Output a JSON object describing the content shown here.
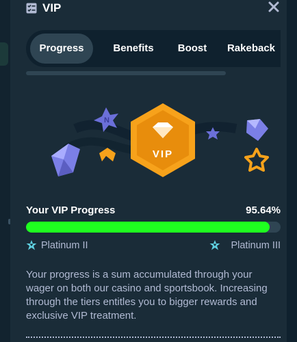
{
  "header": {
    "title": "VIP",
    "icon": "vip-list-icon",
    "close_icon": "close-icon"
  },
  "tabs": [
    {
      "label": "Progress",
      "active": true
    },
    {
      "label": "Benefits",
      "active": false
    },
    {
      "label": "Boost",
      "active": false
    },
    {
      "label": "Rakeback",
      "active": false
    }
  ],
  "illustration": {
    "badge_text": "VIP",
    "icons": [
      "diamond-icon",
      "star-icon",
      "boomerang-icon",
      "star-outline-icon",
      "vip-badge-icon"
    ]
  },
  "progress": {
    "title": "Your VIP Progress",
    "value_text": "95.64%",
    "fraction": 0.9564,
    "current_tier": "Platinum II",
    "next_tier": "Platinum III",
    "tier_icon": "platinum-tier-icon"
  },
  "description": "Your progress is a sum accumulated through your wager on both our casino and sportsbook. Increasing through the tiers entitles you to bigger rewards and exclusive VIP treatment.",
  "colors": {
    "background": "#0f212e",
    "panel": "#1a2c38",
    "tab_active": "#2f4553",
    "progress_fill": "#1fff20",
    "muted_text": "#b1bad3",
    "badge_orange": "#f7a21b"
  }
}
